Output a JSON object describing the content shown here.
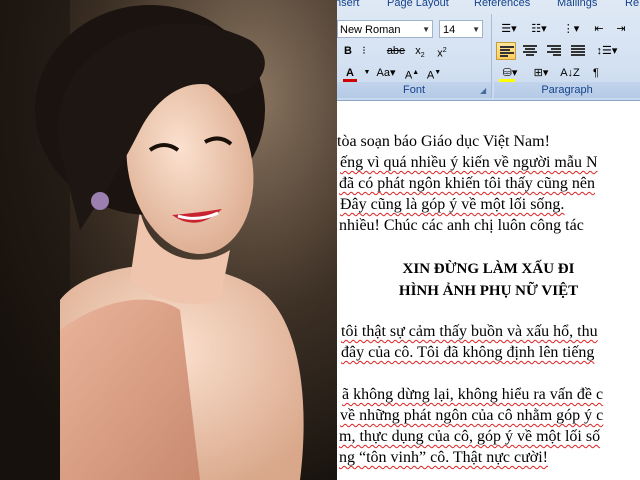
{
  "ribbon": {
    "tabs": [
      "nsert",
      "Page Layout",
      "References",
      "Mailings",
      "Re"
    ],
    "font_name": "New Roman",
    "font_size": "14",
    "font_group_label": "Font",
    "paragraph_group_label": "Paragraph",
    "accent_color": "#15428b",
    "font_color_bar": "#d00000",
    "highlight_color_bar": "#ffff00"
  },
  "document": {
    "lines_top": [
      "tòa soạn báo Giáo dục Việt Nam!",
      "ếng vì quá nhiều ý kiến về người mẫu N",
      "đã có phát ngôn khiến tôi thấy cũng nên",
      "Đây cũng là góp ý về một lối sống.",
      "nhiều! Chúc các anh chị luôn công tác"
    ],
    "heading_1": "XIN ĐỪNG LÀM XẤU ĐI",
    "heading_2": "HÌNH ẢNH PHỤ NỮ VIỆT",
    "lines_mid": [
      "tôi thật sự cảm thấy buồn và xấu hổ, thu",
      "đây của cô. Tôi đã không định lên tiếng"
    ],
    "lines_bottom": [
      "ã không dừng lại, không hiểu ra vấn đề c",
      "về những phát ngôn của cô nhằm góp ý c",
      "m, thực dụng của cô, góp ý về một lối số",
      "ng “tôn vinh” cô. Thật nực cười!"
    ]
  }
}
